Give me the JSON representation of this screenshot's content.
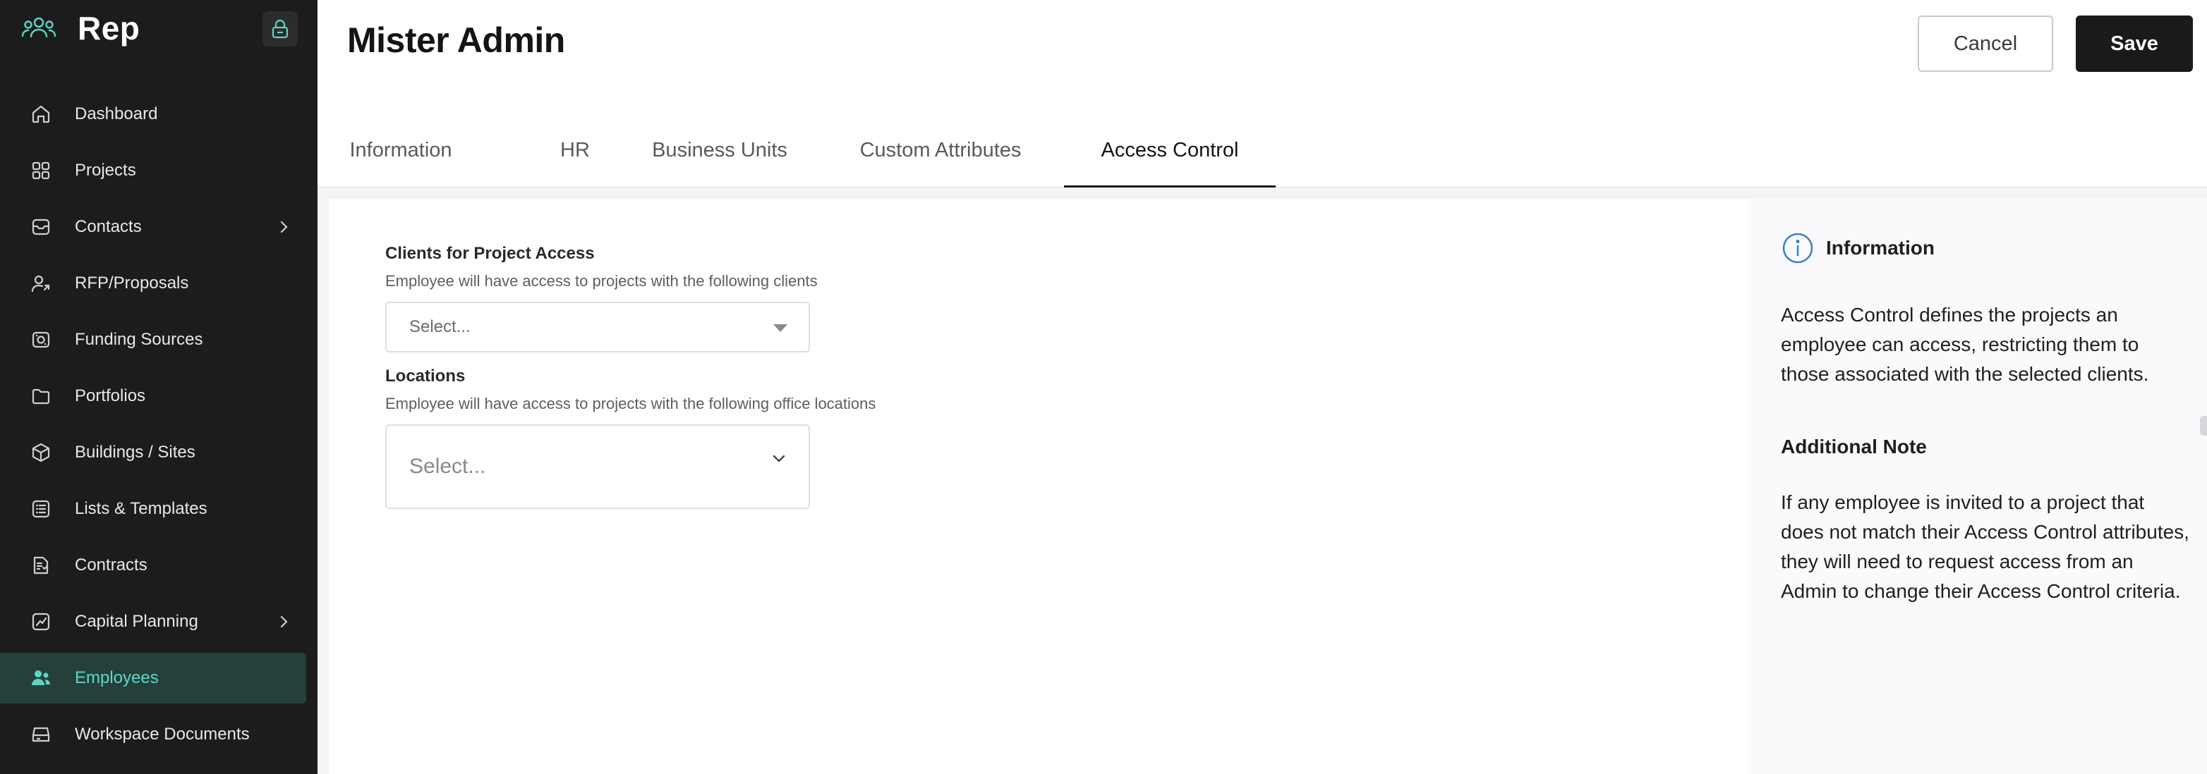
{
  "app": {
    "name": "Rep"
  },
  "sidebar": {
    "items": [
      {
        "label": "Dashboard",
        "icon": "home-icon",
        "active": false,
        "expandable": false
      },
      {
        "label": "Projects",
        "icon": "grid-icon",
        "active": false,
        "expandable": false
      },
      {
        "label": "Contacts",
        "icon": "inbox-icon",
        "active": false,
        "expandable": true
      },
      {
        "label": "RFP/Proposals",
        "icon": "user-arrow-icon",
        "active": false,
        "expandable": false
      },
      {
        "label": "Funding Sources",
        "icon": "money-icon",
        "active": false,
        "expandable": false
      },
      {
        "label": "Portfolios",
        "icon": "folder-icon",
        "active": false,
        "expandable": false
      },
      {
        "label": "Buildings / Sites",
        "icon": "cube-icon",
        "active": false,
        "expandable": false
      },
      {
        "label": "Lists & Templates",
        "icon": "list-icon",
        "active": false,
        "expandable": false
      },
      {
        "label": "Contracts",
        "icon": "contract-icon",
        "active": false,
        "expandable": false
      },
      {
        "label": "Capital Planning",
        "icon": "chart-icon",
        "active": false,
        "expandable": true
      },
      {
        "label": "Employees",
        "icon": "users-icon",
        "active": true,
        "expandable": false
      },
      {
        "label": "Workspace Documents",
        "icon": "drive-icon",
        "active": false,
        "expandable": false
      }
    ]
  },
  "header": {
    "title": "Mister Admin",
    "cancel_label": "Cancel",
    "save_label": "Save"
  },
  "tabs": [
    {
      "label": "Information",
      "active": false
    },
    {
      "label": "HR",
      "active": false
    },
    {
      "label": "Business Units",
      "active": false
    },
    {
      "label": "Custom Attributes",
      "active": false
    },
    {
      "label": "Access Control",
      "active": true
    }
  ],
  "form": {
    "clients": {
      "label": "Clients for Project Access",
      "help": "Employee will have access to projects with the following clients",
      "placeholder": "Select..."
    },
    "locations": {
      "label": "Locations",
      "help": "Employee will have access to projects with the following office locations",
      "placeholder": "Select..."
    }
  },
  "info_panel": {
    "title": "Information",
    "body": "Access Control defines the projects an employee can access, restricting them to those associated with the selected clients.",
    "note_title": "Additional Note",
    "note_body": "If any employee is invited to a project that does not match their Access Control attributes, they will need to request access from an Admin to change their Access Control criteria."
  },
  "colors": {
    "sidebar_bg": "#1c1c1c",
    "active_bg": "#25403b",
    "active_text": "#5fd6c4",
    "primary_button": "#1a1a1a",
    "info_icon": "#3b82c4"
  }
}
